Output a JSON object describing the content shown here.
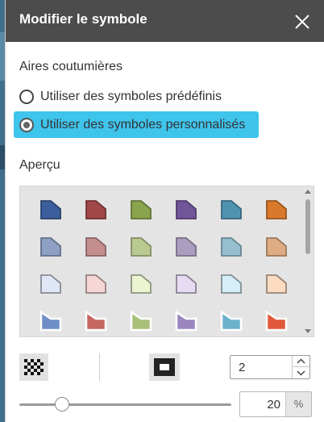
{
  "dialog": {
    "title": "Modifier le symbole",
    "close_icon": "close-icon"
  },
  "layer": {
    "name": "Aires coutumières"
  },
  "options": [
    {
      "label": "Utiliser des symboles prédéfinis",
      "checked": false
    },
    {
      "label": "Utiliser des symboles personnalisés",
      "checked": true
    }
  ],
  "preview": {
    "label": "Aperçu",
    "rows": [
      {
        "style": "dark",
        "colors": [
          "#3d5e9c",
          "#a24848",
          "#8aa44e",
          "#71569a",
          "#4f93b0",
          "#d9792c"
        ]
      },
      {
        "style": "medium",
        "colors": [
          "#8e9fc4",
          "#c48e8e",
          "#b9c990",
          "#ab9dc0",
          "#95bfcf",
          "#dfab82"
        ]
      },
      {
        "style": "light",
        "colors": [
          "#dfe7f7",
          "#f7d6d6",
          "#ecf5d2",
          "#e5dbf2",
          "#d6eef7",
          "#fbdcc2"
        ]
      },
      {
        "style": "solid",
        "colors": [
          "#6e8ec7",
          "#c56661",
          "#a8c07a",
          "#9a85bd",
          "#6cb2cc",
          "#e1573a"
        ]
      }
    ]
  },
  "controls": {
    "pattern_icon": "checker-pattern-icon",
    "fill_icon": "fill-style-icon",
    "outline_width": "2",
    "transparency": "20",
    "transparency_unit": "%",
    "transparency_level": 0.2
  },
  "colors": {
    "titlebar": "#4c4c4c",
    "highlight": "#3fc4ec"
  }
}
